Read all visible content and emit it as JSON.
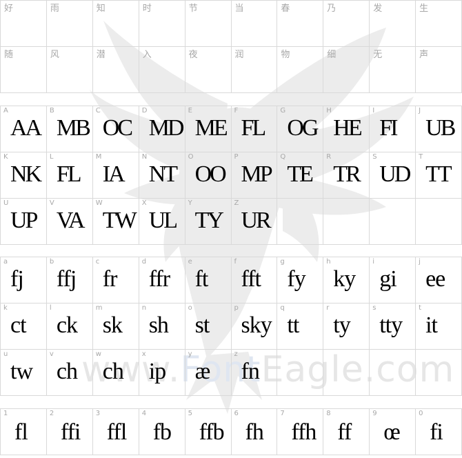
{
  "watermark": {
    "text_left": "www.",
    "text_mid": "Font",
    "text_right": "Eagle.com",
    "logo_icon": "eagle-icon"
  },
  "cjk": [
    "好",
    "雨",
    "知",
    "时",
    "节",
    "当",
    "春",
    "乃",
    "发",
    "生",
    "随",
    "风",
    "潜",
    "入",
    "夜",
    "润",
    "物",
    "细",
    "无",
    "声"
  ],
  "uppercase": [
    {
      "label": "A",
      "glyph": "AA"
    },
    {
      "label": "B",
      "glyph": "MB"
    },
    {
      "label": "C",
      "glyph": "OC"
    },
    {
      "label": "D",
      "glyph": "MD"
    },
    {
      "label": "E",
      "glyph": "ME"
    },
    {
      "label": "F",
      "glyph": "FL"
    },
    {
      "label": "G",
      "glyph": "OG"
    },
    {
      "label": "H",
      "glyph": "HE"
    },
    {
      "label": "I",
      "glyph": "FI"
    },
    {
      "label": "J",
      "glyph": "UB"
    },
    {
      "label": "K",
      "glyph": "NK"
    },
    {
      "label": "L",
      "glyph": "FL"
    },
    {
      "label": "M",
      "glyph": "IA"
    },
    {
      "label": "N",
      "glyph": "NT"
    },
    {
      "label": "O",
      "glyph": "OO"
    },
    {
      "label": "P",
      "glyph": "MP"
    },
    {
      "label": "Q",
      "glyph": "TE"
    },
    {
      "label": "R",
      "glyph": "TR"
    },
    {
      "label": "S",
      "glyph": "UD"
    },
    {
      "label": "T",
      "glyph": "TT"
    },
    {
      "label": "U",
      "glyph": "UP"
    },
    {
      "label": "V",
      "glyph": "VA"
    },
    {
      "label": "W",
      "glyph": "TW"
    },
    {
      "label": "X",
      "glyph": "UL"
    },
    {
      "label": "Y",
      "glyph": "TY"
    },
    {
      "label": "Z",
      "glyph": "UR"
    }
  ],
  "lowercase": [
    {
      "label": "a",
      "glyph": "fj"
    },
    {
      "label": "b",
      "glyph": "ffj"
    },
    {
      "label": "c",
      "glyph": "fr"
    },
    {
      "label": "d",
      "glyph": "ffr"
    },
    {
      "label": "e",
      "glyph": "ft"
    },
    {
      "label": "f",
      "glyph": "fft"
    },
    {
      "label": "g",
      "glyph": "fy"
    },
    {
      "label": "h",
      "glyph": "ky"
    },
    {
      "label": "i",
      "glyph": "gi"
    },
    {
      "label": "j",
      "glyph": "ee"
    },
    {
      "label": "k",
      "glyph": "ct"
    },
    {
      "label": "l",
      "glyph": "ck"
    },
    {
      "label": "m",
      "glyph": "sk"
    },
    {
      "label": "n",
      "glyph": "sh"
    },
    {
      "label": "o",
      "glyph": "st"
    },
    {
      "label": "p",
      "glyph": "sky"
    },
    {
      "label": "q",
      "glyph": "tt"
    },
    {
      "label": "r",
      "glyph": "ty"
    },
    {
      "label": "s",
      "glyph": "tty"
    },
    {
      "label": "t",
      "glyph": "it"
    },
    {
      "label": "u",
      "glyph": "tw"
    },
    {
      "label": "v",
      "glyph": "ch"
    },
    {
      "label": "w",
      "glyph": "ch"
    },
    {
      "label": "x",
      "glyph": "ip"
    },
    {
      "label": "y",
      "glyph": "æ"
    },
    {
      "label": "z",
      "glyph": "fn"
    }
  ],
  "digits": [
    {
      "label": "1",
      "glyph": "fl"
    },
    {
      "label": "2",
      "glyph": "ffi"
    },
    {
      "label": "3",
      "glyph": "ffl"
    },
    {
      "label": "4",
      "glyph": "fb"
    },
    {
      "label": "5",
      "glyph": "ffb"
    },
    {
      "label": "6",
      "glyph": "fh"
    },
    {
      "label": "7",
      "glyph": "ffh"
    },
    {
      "label": "8",
      "glyph": "ff"
    },
    {
      "label": "9",
      "glyph": "œ"
    },
    {
      "label": "0",
      "glyph": "fi"
    }
  ]
}
